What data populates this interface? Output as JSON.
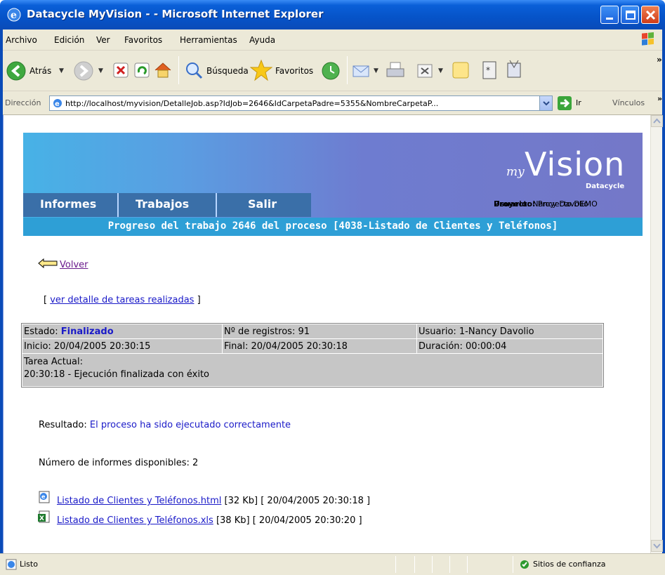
{
  "window": {
    "title": "Datacycle MyVision - - Microsoft Internet Explorer"
  },
  "menu": [
    "Archivo",
    "Edición",
    "Ver",
    "Favoritos",
    "Herramientas",
    "Ayuda"
  ],
  "toolbar": {
    "back_label": "Atrás",
    "search_label": "Búsqueda",
    "favorites_label": "Favoritos"
  },
  "address": {
    "label": "Dirección",
    "url": "http://localhost/myvision/DetalleJob.asp?IdJob=2646&IdCarpetaPadre=5355&NombreCarpetaP...",
    "go_label": "Ir",
    "links_label": "Vínculos"
  },
  "banner": {
    "logo_my": "my",
    "logo_vision": "Vision",
    "logo_sub": "Datacycle",
    "nav": [
      "Informes",
      "Trabajos",
      "Salir"
    ],
    "user_label": "Usuario:",
    "user_value": "Nancy Davolio",
    "project_label": "Proyecto:",
    "project_value": "Proyecto DEMO"
  },
  "progress_title": "Progreso del trabajo 2646 del proceso [4038-Listado de Clientes y Teléfonos]",
  "back_link": "Volver",
  "detail": {
    "open": "[",
    "link": "ver detalle de tareas realizadas",
    "close": "]"
  },
  "status": {
    "estado_label": "Estado:",
    "estado_value": "Finalizado",
    "registros": "Nº de registros: 91",
    "usuario": "Usuario: 1-Nancy Davolio",
    "inicio": "Inicio: 20/04/2005 20:30:15",
    "final": "Final: 20/04/2005 20:30:18",
    "duracion": "Duración: 00:00:04",
    "tarea_label": "Tarea Actual:",
    "tarea_value": "20:30:18 - Ejecución finalizada con éxito"
  },
  "result": {
    "label": "Resultado:",
    "value": "El proceso ha sido ejecutado correctamente"
  },
  "num_informes": "Número de informes disponibles: 2",
  "files": [
    {
      "name": "Listado de Clientes y Teléfonos.html",
      "meta": "[32 Kb] [ 20/04/2005 20:30:18 ]",
      "icon": "html-file-icon"
    },
    {
      "name": "Listado de Clientes y Teléfonos.xls",
      "meta": "[38 Kb] [ 20/04/2005 20:30:20 ]",
      "icon": "excel-file-icon"
    }
  ],
  "statusbar": {
    "text": "Listo",
    "zone": "Sitios de confianza"
  },
  "colors": {
    "titlebar": "#0653c8",
    "banner_nav": "#3a6fa8",
    "progress_bar": "#2e9fd6",
    "link": "#1a1ac8",
    "table_cell": "#c6c6c6"
  }
}
